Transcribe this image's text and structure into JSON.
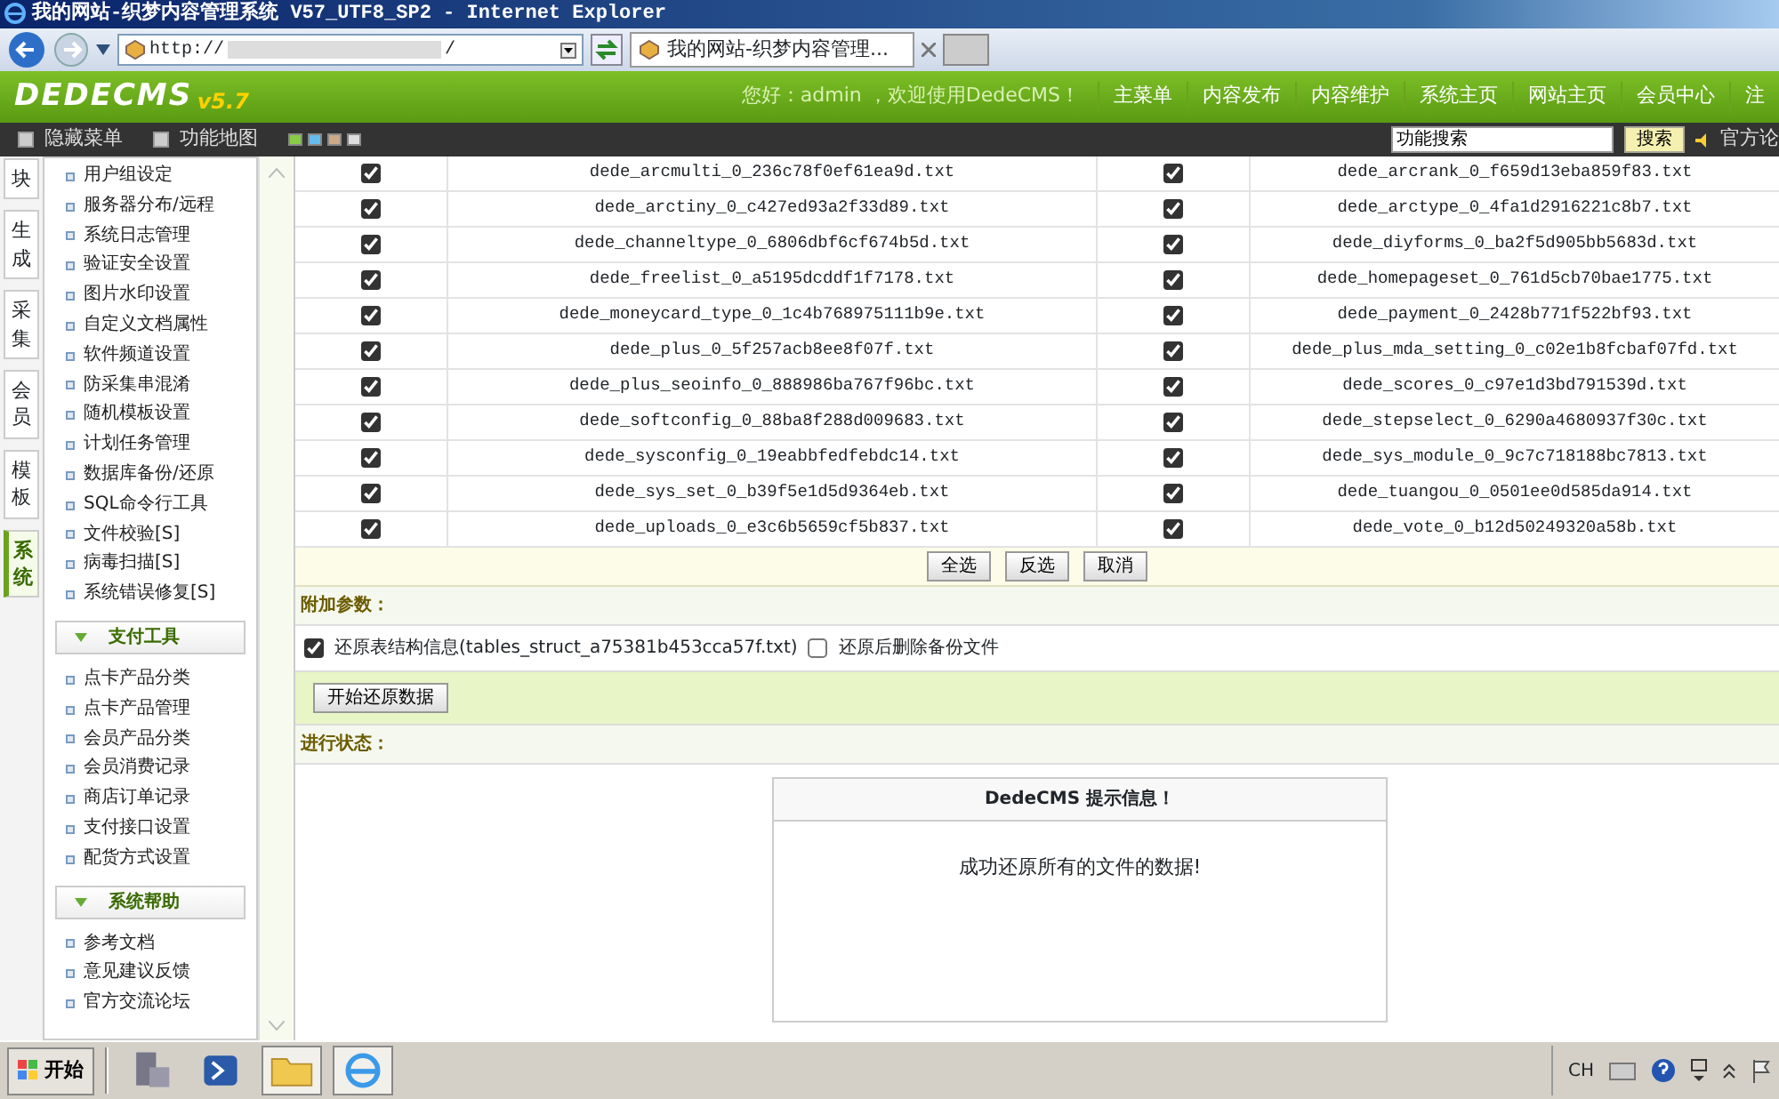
{
  "window": {
    "title": "我的网站-织梦内容管理系统 V57_UTF8_SP2 - Internet Explorer"
  },
  "browser": {
    "address_start": "http://",
    "address_end": "/",
    "tab_title": "我的网站-织梦内容管理..."
  },
  "header": {
    "logo": "DEDECMS",
    "version": "v5.7",
    "greeting": "您好：admin ，欢迎使用DedeCMS！",
    "nav": [
      "主菜单",
      "内容发布",
      "内容维护",
      "系统主页",
      "网站主页",
      "会员中心",
      "注"
    ]
  },
  "toolbar": {
    "links": [
      "隐藏菜单",
      "功能地图"
    ],
    "search_value": "功能搜索",
    "search_button": "搜索",
    "forum": "官方论"
  },
  "sidebar": {
    "tabs": [
      {
        "label": "块",
        "selected": false
      },
      {
        "label": "生成",
        "selected": false
      },
      {
        "label": "采集",
        "selected": false
      },
      {
        "label": "会员",
        "selected": false
      },
      {
        "label": "模板",
        "selected": false
      },
      {
        "label": "系统",
        "selected": true
      }
    ],
    "groups": [
      {
        "items": [
          "用户组设定",
          "服务器分布/远程",
          "系统日志管理",
          "验证安全设置",
          "图片水印设置",
          "自定义文档属性",
          "软件频道设置",
          "防采集串混淆",
          "随机模板设置",
          "计划任务管理",
          "数据库备份/还原",
          "SQL命令行工具",
          "文件校验[S]",
          "病毒扫描[S]",
          "系统错误修复[S]"
        ]
      },
      {
        "title": "支付工具",
        "items": [
          "点卡产品分类",
          "点卡产品管理",
          "会员产品分类",
          "会员消费记录",
          "商店订单记录",
          "支付接口设置",
          "配货方式设置"
        ]
      },
      {
        "title": "系统帮助",
        "items": [
          "参考文档",
          "意见建议反馈",
          "官方交流论坛"
        ]
      }
    ]
  },
  "files": [
    [
      {
        "name": "dede_arcmulti_0_236c78f0ef61ea9d.txt",
        "checked": true
      },
      {
        "name": "dede_arcrank_0_f659d13eba859f83.txt",
        "checked": true
      }
    ],
    [
      {
        "name": "dede_arctiny_0_c427ed93a2f33d89.txt",
        "checked": true
      },
      {
        "name": "dede_arctype_0_4fa1d2916221c8b7.txt",
        "checked": true
      }
    ],
    [
      {
        "name": "dede_channeltype_0_6806dbf6cf674b5d.txt",
        "checked": true
      },
      {
        "name": "dede_diyforms_0_ba2f5d905bb5683d.txt",
        "checked": true
      }
    ],
    [
      {
        "name": "dede_freelist_0_a5195dcddf1f7178.txt",
        "checked": true
      },
      {
        "name": "dede_homepageset_0_761d5cb70bae1775.txt",
        "checked": true
      }
    ],
    [
      {
        "name": "dede_moneycard_type_0_1c4b768975111b9e.txt",
        "checked": true
      },
      {
        "name": "dede_payment_0_2428b771f522bf93.txt",
        "checked": true
      }
    ],
    [
      {
        "name": "dede_plus_0_5f257acb8ee8f07f.txt",
        "checked": true
      },
      {
        "name": "dede_plus_mda_setting_0_c02e1b8fcbaf07fd.txt",
        "checked": true
      }
    ],
    [
      {
        "name": "dede_plus_seoinfo_0_888986ba767f96bc.txt",
        "checked": true
      },
      {
        "name": "dede_scores_0_c97e1d3bd791539d.txt",
        "checked": true
      }
    ],
    [
      {
        "name": "dede_softconfig_0_88ba8f288d009683.txt",
        "checked": true
      },
      {
        "name": "dede_stepselect_0_6290a4680937f30c.txt",
        "checked": true
      }
    ],
    [
      {
        "name": "dede_sysconfig_0_19eabbfedfebdc14.txt",
        "checked": true
      },
      {
        "name": "dede_sys_module_0_9c7c718188bc7813.txt",
        "checked": true
      }
    ],
    [
      {
        "name": "dede_sys_set_0_b39f5e1d5d9364eb.txt",
        "checked": true
      },
      {
        "name": "dede_tuangou_0_0501ee0d585da914.txt",
        "checked": true
      }
    ],
    [
      {
        "name": "dede_uploads_0_e3c6b5659cf5b837.txt",
        "checked": true
      },
      {
        "name": "dede_vote_0_b12d50249320a58b.txt",
        "checked": true
      }
    ]
  ],
  "select_buttons": [
    "全选",
    "反选",
    "取消"
  ],
  "params_heading": "附加参数：",
  "options": [
    {
      "label": "还原表结构信息(tables_struct_a75381b453cca57f.txt)",
      "checked": true
    },
    {
      "label": "还原后删除备份文件",
      "checked": false
    }
  ],
  "start_button": "开始还原数据",
  "status_heading": "进行状态：",
  "message": {
    "title": "DedeCMS 提示信息！",
    "body": "成功还原所有的文件的数据!"
  },
  "taskbar": {
    "start": "开始",
    "language": "CH"
  }
}
